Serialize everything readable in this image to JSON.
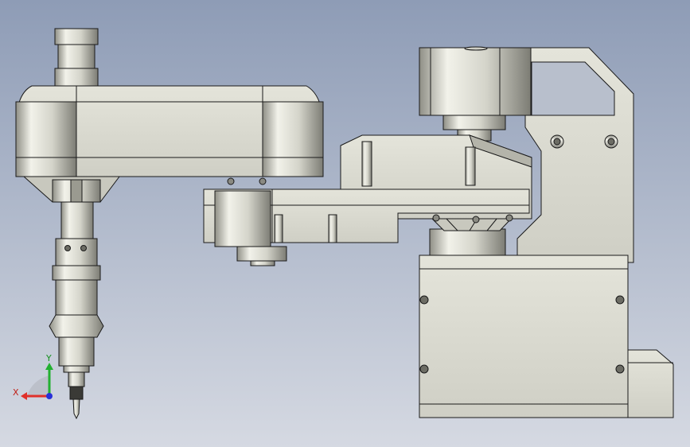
{
  "viewport": {
    "background_top": "#8e9cb6",
    "background_bottom": "#d3d7e0",
    "part_fill": "#dcdcd2",
    "part_shadow": "#9a9a90",
    "edge": "#1a1a1a"
  },
  "triad": {
    "x_label": "X",
    "y_label": "Y",
    "x_color": "#e0302a",
    "y_color": "#22b030",
    "z_color": "#2830d8"
  }
}
